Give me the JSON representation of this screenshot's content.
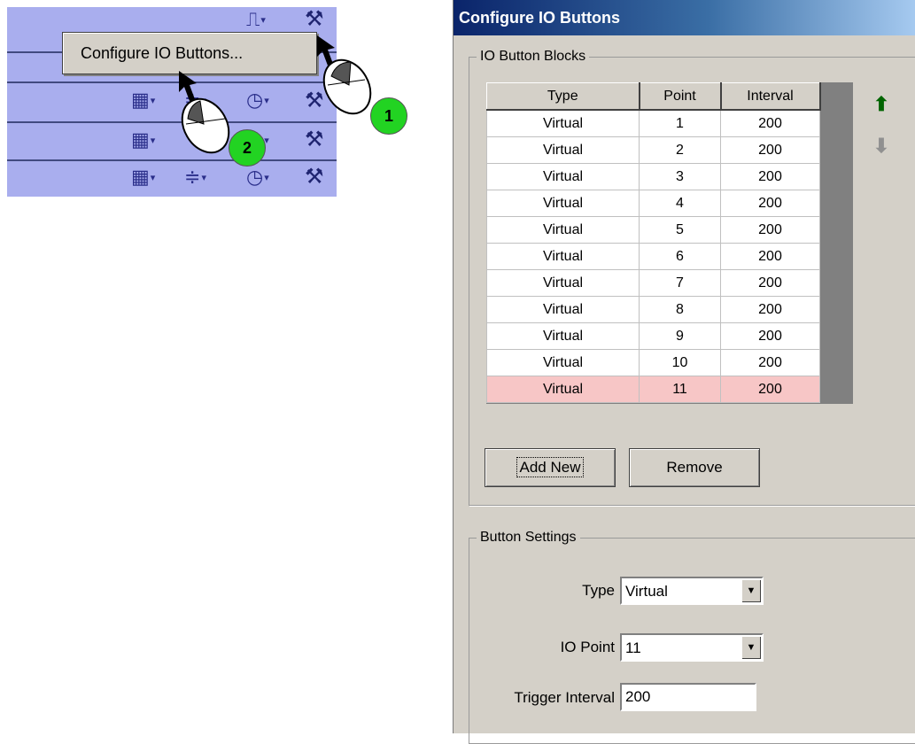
{
  "context_menu": {
    "item_label": "Configure IO Buttons..."
  },
  "callouts": {
    "step1": "1",
    "step2": "2"
  },
  "dialog": {
    "title": "Configure IO Buttons",
    "blocks_group_label": "IO Button Blocks",
    "table": {
      "columns": [
        "Type",
        "Point",
        "Interval"
      ],
      "rows": [
        [
          "Virtual",
          "1",
          "200"
        ],
        [
          "Virtual",
          "2",
          "200"
        ],
        [
          "Virtual",
          "3",
          "200"
        ],
        [
          "Virtual",
          "4",
          "200"
        ],
        [
          "Virtual",
          "5",
          "200"
        ],
        [
          "Virtual",
          "6",
          "200"
        ],
        [
          "Virtual",
          "7",
          "200"
        ],
        [
          "Virtual",
          "8",
          "200"
        ],
        [
          "Virtual",
          "9",
          "200"
        ],
        [
          "Virtual",
          "10",
          "200"
        ],
        [
          "Virtual",
          "11",
          "200"
        ]
      ],
      "selected_row_index": 10
    },
    "add_new_label": "Add New",
    "remove_label": "Remove",
    "settings_group_label": "Button Settings",
    "type_label": "Type",
    "type_value": "Virtual",
    "io_point_label": "IO Point",
    "io_point_value": "11",
    "trigger_interval_label": "Trigger Interval",
    "trigger_interval_value": "200"
  },
  "colors": {
    "selected_row": "#f7c6c6",
    "title_bar": "#0a246a",
    "toolbar": "#a9aeee",
    "callout": "#22d322"
  }
}
